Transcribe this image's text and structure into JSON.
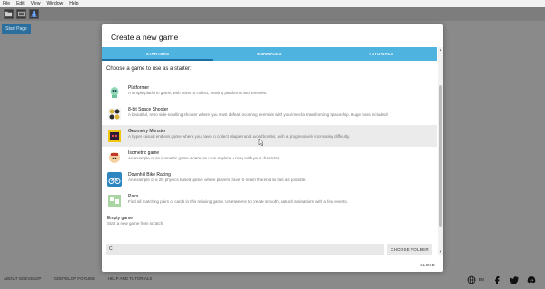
{
  "menubar": {
    "items": [
      "File",
      "Edit",
      "View",
      "Window",
      "Help"
    ]
  },
  "toolbar": {
    "icons": [
      "folder-icon",
      "film-icon",
      "bug-icon"
    ]
  },
  "start_tab": {
    "label": "Start Page"
  },
  "dialog": {
    "title": "Create a new game",
    "tabs": [
      "STARTERS",
      "EXAMPLES",
      "TUTORIALS"
    ],
    "prompt": "Choose a game to use as a starter:",
    "items": [
      {
        "title": "Platformer",
        "desc": "A simple platform game, with coins to collect, moving platforms and enemies.",
        "icon": "platformer-icon"
      },
      {
        "title": "8-bit Space Shooter",
        "desc": "A beautiful, retro side-scrolling shooter where you must defeat incoming enemies with your mecha transforming spaceship. Huge boss included!",
        "icon": "space-shooter-icon"
      },
      {
        "title": "Geometry Monster",
        "desc": "A hyper casual endless game where you have to collect shapes and avoid bombs, with a progressively increasing difficulty.",
        "icon": "geometry-monster-icon"
      },
      {
        "title": "Isometric game",
        "desc": "An example of an isometric game where you can explore a map with your character.",
        "icon": "isometric-icon"
      },
      {
        "title": "Downhill Bike Racing",
        "desc": "An example of a 2D physics based game, where players have to reach the end as fast as possible.",
        "icon": "bike-icon"
      },
      {
        "title": "Pairs",
        "desc": "Find all matching pairs of cards in this relaxing game. Use tweens to create smooth, natural animations with a few events.",
        "icon": "pairs-icon"
      }
    ],
    "empty": {
      "title": "Empty game",
      "desc": "Start a new game from scratch."
    },
    "folder_value": "C",
    "choose_folder": "CHOOSE FOLDER",
    "close": "CLOSE"
  },
  "footer": {
    "links": [
      "ABOUT GDEVELOP",
      "GDEVELOP FORUMS",
      "HELP AND TUTORIALS"
    ],
    "lang": "EN"
  },
  "colors": {
    "tab_bar": "#4fb3e0",
    "tab_indicator": "#1a6fa3",
    "selected_row": "#ebebeb",
    "start_tab": "#2b6f9e"
  }
}
